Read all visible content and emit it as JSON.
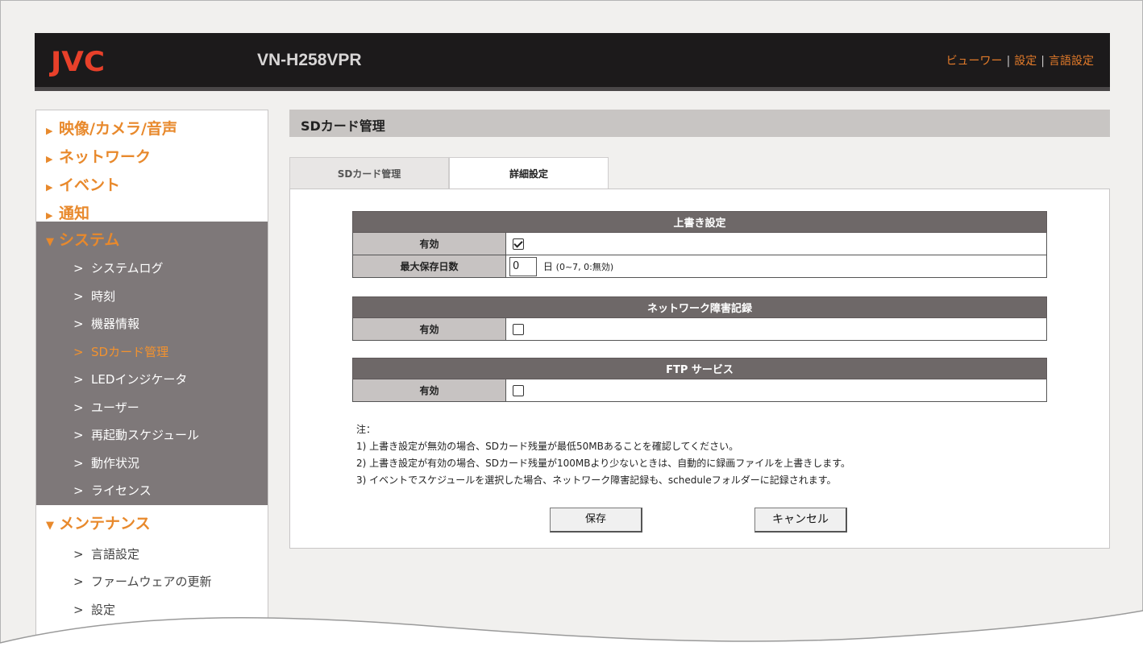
{
  "header": {
    "logo": "JVC",
    "model": "VN-H258VPR",
    "links": [
      "ビューワー",
      "設定",
      "言語設定"
    ],
    "colors": {
      "bar": "#1c1a1b",
      "logo": "#e8402a",
      "accent": "#e37b2a"
    }
  },
  "sidebar": {
    "sections_collapsed": [
      {
        "label": "映像/カメラ/音声"
      },
      {
        "label": "ネットワーク"
      },
      {
        "label": "イベント"
      },
      {
        "label": "通知"
      }
    ],
    "system": {
      "label": "システム",
      "items": [
        {
          "label": "システムログ"
        },
        {
          "label": "時刻"
        },
        {
          "label": "機器情報"
        },
        {
          "label": "SDカード管理",
          "active": true
        },
        {
          "label": "LEDインジケータ"
        },
        {
          "label": "ユーザー"
        },
        {
          "label": "再起動スケジュール"
        },
        {
          "label": "動作状況"
        },
        {
          "label": "ライセンス"
        }
      ]
    },
    "maintenance": {
      "label": "メンテナンス",
      "items": [
        {
          "label": "言語設定"
        },
        {
          "label": "ファームウェアの更新"
        },
        {
          "label": "設定"
        }
      ]
    },
    "collapsed_marker": "▶",
    "open_marker": "▼",
    "item_marker": ">"
  },
  "main": {
    "title": "SDカード管理",
    "tabs": [
      {
        "label": "SDカード管理",
        "selected": false
      },
      {
        "label": "詳細設定",
        "selected": true
      }
    ],
    "overwrite": {
      "header": "上書き設定",
      "enable_label": "有効",
      "enabled": true,
      "days_label": "最大保存日数",
      "days_value": "0",
      "days_unit": "日",
      "days_hint": "(0~7, 0:無効)"
    },
    "network_fail": {
      "header": "ネットワーク障害記録",
      "enable_label": "有効",
      "enabled": false
    },
    "ftp": {
      "header": "FTP サービス",
      "enable_label": "有効",
      "enabled": false
    },
    "notes": {
      "title": "注：",
      "lines": [
        "1) 上書き設定が無効の場合、SDカード残量が最低50MBあることを確認してください。",
        "2) 上書き設定が有効の場合、SDカード残量が100MBより少ないときは、自動的に録画ファイルを上書きします。",
        "3) イベントでスケジュールを選択した場合、ネットワーク障害記録も、scheduleフォルダーに記録されます。"
      ]
    },
    "buttons": {
      "save": "保存",
      "cancel": "キャンセル"
    }
  }
}
